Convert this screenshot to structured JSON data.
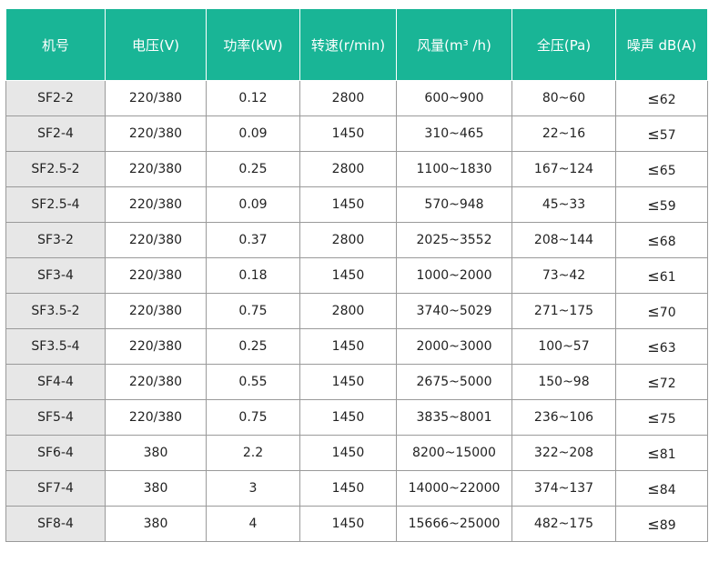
{
  "table": {
    "headers": [
      "机号",
      "电压(V)",
      "功率(kW)",
      "转速(r/min)",
      "风量(m³ /h)",
      "全压(Pa)",
      "噪声 dB(A)"
    ],
    "noise_prefix": "≤",
    "rows": [
      [
        "SF2-2",
        "220/380",
        "0.12",
        "2800",
        "600~900",
        "80~60",
        "62"
      ],
      [
        "SF2-4",
        "220/380",
        "0.09",
        "1450",
        "310~465",
        "22~16",
        "57"
      ],
      [
        "SF2.5-2",
        "220/380",
        "0.25",
        "2800",
        "1100~1830",
        "167~124",
        "65"
      ],
      [
        "SF2.5-4",
        "220/380",
        "0.09",
        "1450",
        "570~948",
        "45~33",
        "59"
      ],
      [
        "SF3-2",
        "220/380",
        "0.37",
        "2800",
        "2025~3552",
        "208~144",
        "68"
      ],
      [
        "SF3-4",
        "220/380",
        "0.18",
        "1450",
        "1000~2000",
        "73~42",
        "61"
      ],
      [
        "SF3.5-2",
        "220/380",
        "0.75",
        "2800",
        "3740~5029",
        "271~175",
        "70"
      ],
      [
        "SF3.5-4",
        "220/380",
        "0.25",
        "1450",
        "2000~3000",
        "100~57",
        "63"
      ],
      [
        "SF4-4",
        "220/380",
        "0.55",
        "1450",
        "2675~5000",
        "150~98",
        "72"
      ],
      [
        "SF5-4",
        "220/380",
        "0.75",
        "1450",
        "3835~8001",
        "236~106",
        "75"
      ],
      [
        "SF6-4",
        "380",
        "2.2",
        "1450",
        "8200~15000",
        "322~208",
        "81"
      ],
      [
        "SF7-4",
        "380",
        "3",
        "1450",
        "14000~22000",
        "374~137",
        "84"
      ],
      [
        "SF8-4",
        "380",
        "4",
        "1450",
        "15666~25000",
        "482~175",
        "89"
      ]
    ]
  }
}
